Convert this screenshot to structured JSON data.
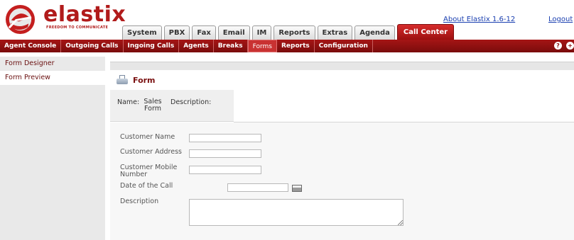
{
  "brand": {
    "name": "elastix",
    "tagline": "FREEDOM TO COMMUNICATE",
    "color": "#b11b1b"
  },
  "top_links": {
    "about": "About Elastix 1.6-12",
    "logout": "Logout"
  },
  "main_tabs": [
    {
      "label": "System"
    },
    {
      "label": "PBX"
    },
    {
      "label": "Fax"
    },
    {
      "label": "Email"
    },
    {
      "label": "IM"
    },
    {
      "label": "Reports"
    },
    {
      "label": "Extras"
    },
    {
      "label": "Agenda"
    },
    {
      "label": "Call Center",
      "active": true
    }
  ],
  "sub_nav": [
    {
      "label": "Agent Console"
    },
    {
      "label": "Outgoing Calls"
    },
    {
      "label": "Ingoing Calls"
    },
    {
      "label": "Agents"
    },
    {
      "label": "Breaks"
    },
    {
      "label": "Forms",
      "active": true
    },
    {
      "label": "Reports"
    },
    {
      "label": "Configuration"
    }
  ],
  "sub_nav_icons": [
    "help-icon",
    "add-icon"
  ],
  "left_menu": [
    {
      "label": "Form Designer"
    },
    {
      "label": "Form Preview"
    }
  ],
  "page": {
    "title": "Form",
    "name_label": "Name:",
    "name_value": "Sales Form",
    "description_label": "Description:"
  },
  "form_fields": {
    "customer_name": {
      "label": "Customer Name",
      "value": ""
    },
    "customer_address": {
      "label": "Customer Address",
      "value": ""
    },
    "customer_mobile": {
      "label": "Customer Mobile Number",
      "value": ""
    },
    "call_date": {
      "label": "Date of the Call",
      "value": ""
    },
    "description": {
      "label": "Description",
      "value": ""
    }
  }
}
